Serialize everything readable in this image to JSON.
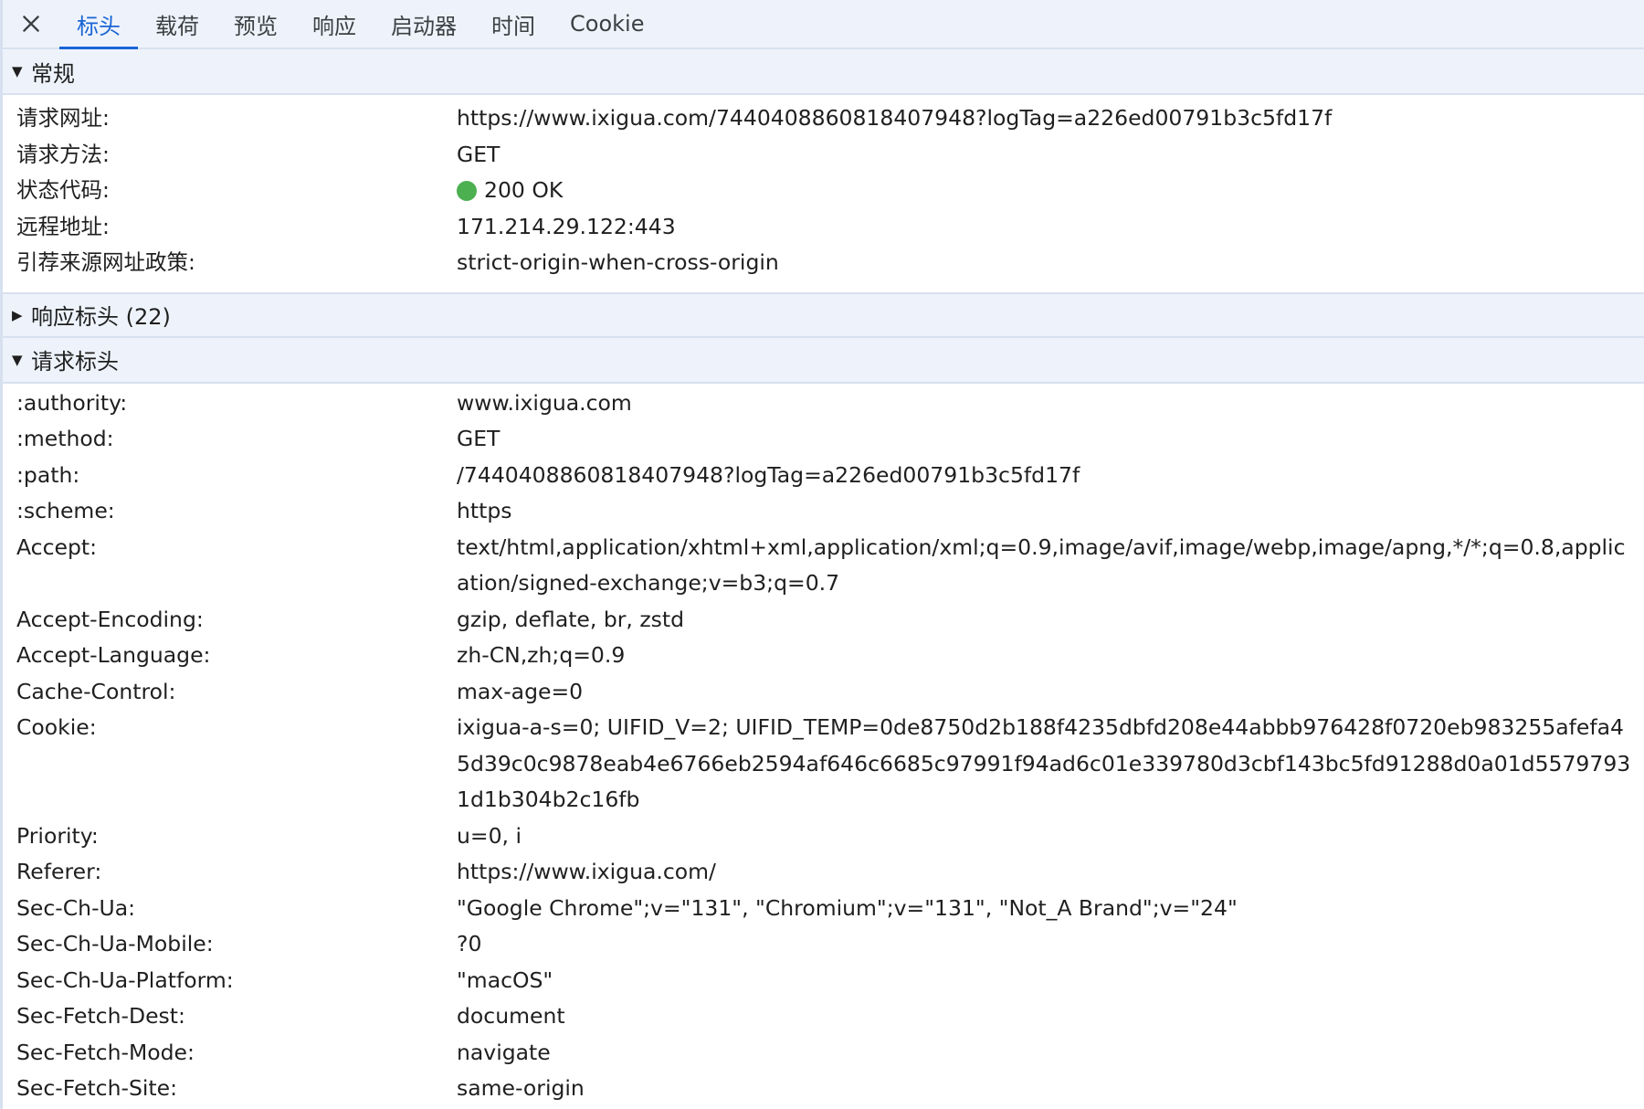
{
  "tabs": [
    {
      "label": "标头",
      "active": true
    },
    {
      "label": "载荷",
      "active": false
    },
    {
      "label": "预览",
      "active": false
    },
    {
      "label": "响应",
      "active": false
    },
    {
      "label": "启动器",
      "active": false
    },
    {
      "label": "时间",
      "active": false
    },
    {
      "label": "Cookie",
      "active": false
    }
  ],
  "general": {
    "title": "常规",
    "rows": [
      {
        "k": "请求网址:",
        "v": "https://www.ixigua.com/7440408860818407948?logTag=a226ed00791b3c5fd17f"
      },
      {
        "k": "请求方法:",
        "v": "GET"
      },
      {
        "k": "状态代码:",
        "v": "200 OK"
      },
      {
        "k": "远程地址:",
        "v": "171.214.29.122:443"
      },
      {
        "k": "引荐来源网址政策:",
        "v": "strict-origin-when-cross-origin"
      }
    ]
  },
  "response_headers": {
    "title": "响应标头 (22)"
  },
  "request_headers": {
    "title": "请求标头",
    "rows": [
      {
        "k": ":authority:",
        "v": "www.ixigua.com"
      },
      {
        "k": ":method:",
        "v": "GET"
      },
      {
        "k": ":path:",
        "v": "/7440408860818407948?logTag=a226ed00791b3c5fd17f"
      },
      {
        "k": ":scheme:",
        "v": "https"
      },
      {
        "k": "Accept:",
        "v": "text/html,application/xhtml+xml,application/xml;q=0.9,image/avif,image/webp,image/apng,*/*;q=0.8,application/signed-exchange;v=b3;q=0.7"
      },
      {
        "k": "Accept-Encoding:",
        "v": "gzip, deflate, br, zstd"
      },
      {
        "k": "Accept-Language:",
        "v": "zh-CN,zh;q=0.9"
      },
      {
        "k": "Cache-Control:",
        "v": "max-age=0"
      },
      {
        "k": "Cookie:",
        "v": "ixigua-a-s=0; UIFID_V=2; UIFID_TEMP=0de8750d2b188f4235dbfd208e44abbb976428f0720eb983255afefa45d39c0c9878eab4e6766eb2594af646c6685c97991f94ad6c01e339780d3cbf143bc5fd91288d0a01d55797931d1b304b2c16fb"
      },
      {
        "k": "Priority:",
        "v": "u=0, i"
      },
      {
        "k": "Referer:",
        "v": "https://www.ixigua.com/"
      },
      {
        "k": "Sec-Ch-Ua:",
        "v": "\"Google Chrome\";v=\"131\", \"Chromium\";v=\"131\", \"Not_A Brand\";v=\"24\""
      },
      {
        "k": "Sec-Ch-Ua-Mobile:",
        "v": "?0"
      },
      {
        "k": "Sec-Ch-Ua-Platform:",
        "v": "\"macOS\""
      },
      {
        "k": "Sec-Fetch-Dest:",
        "v": "document"
      },
      {
        "k": "Sec-Fetch-Mode:",
        "v": "navigate"
      },
      {
        "k": "Sec-Fetch-Site:",
        "v": "same-origin"
      }
    ]
  },
  "colors": {
    "accent": "#1a64d6",
    "status_ok": "#4caf50",
    "header_bg": "#eef3fb"
  }
}
